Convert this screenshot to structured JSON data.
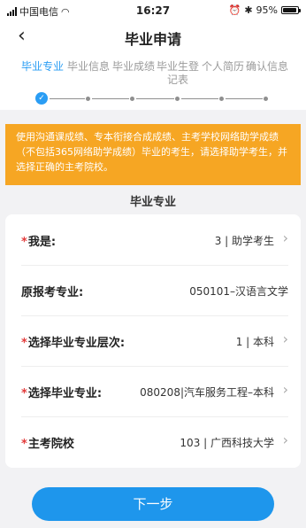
{
  "status_bar": {
    "carrier": "中国电信",
    "time": "16:27",
    "battery": "95%",
    "battery_level": 0.95
  },
  "nav": {
    "title": "毕业申请",
    "back_icon": "chevron-left-icon"
  },
  "steps": [
    {
      "label": "毕业专业",
      "active": true
    },
    {
      "label": "毕业信息",
      "active": false
    },
    {
      "label": "毕业成绩",
      "active": false
    },
    {
      "label": "毕业生登记表",
      "active": false
    },
    {
      "label": "个人简历",
      "active": false
    },
    {
      "label": "确认信息",
      "active": false
    }
  ],
  "notice": "使用沟通课成绩、专本衔接合成成绩、主考学校网络助学成绩（不包括365网络助学成绩）毕业的考生，请选择助学考生，并选择正确的主考院校。",
  "section_title": "毕业专业",
  "form": {
    "rows": [
      {
        "label": "我是:",
        "required": true,
        "value": "3 | 助学考生",
        "has_arrow": true
      },
      {
        "label": "原报考专业:",
        "required": false,
        "value": "050101–汉语言文学",
        "has_arrow": false
      },
      {
        "label": "选择毕业专业层次:",
        "required": true,
        "value": "1 | 本科",
        "has_arrow": true
      },
      {
        "label": "选择毕业专业:",
        "required": true,
        "value": "080208|汽车服务工程–本科",
        "has_arrow": true
      },
      {
        "label": "主考院校",
        "required": true,
        "value": "103 | 广西科技大学",
        "has_arrow": true
      }
    ]
  },
  "next_button": "下一步",
  "colors": {
    "accent": "#2a9df4",
    "notice_bg": "#f6a623",
    "button": "#1e96ec",
    "required": "#e23b3b"
  }
}
